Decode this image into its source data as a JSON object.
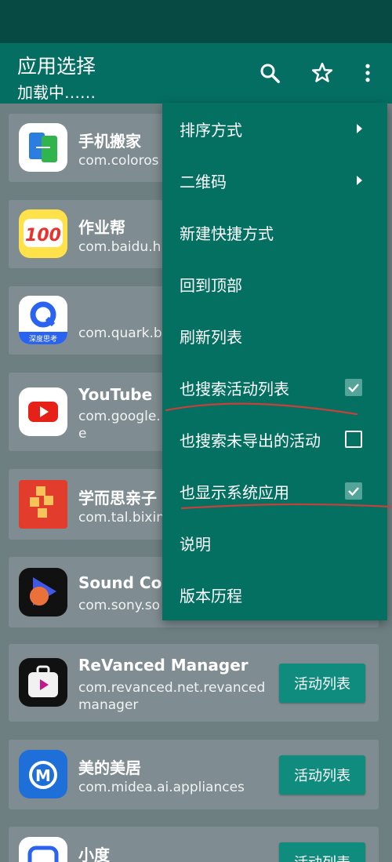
{
  "appbar": {
    "title": "应用选择",
    "subtitle": "加载中……"
  },
  "apps": [
    {
      "name": "手机搬家",
      "package": "com.coloros"
    },
    {
      "name": "作业帮",
      "package": "com.baidu.h"
    },
    {
      "name": "",
      "package": "com.quark.b",
      "icon_text": "深度思考"
    },
    {
      "name": "YouTube",
      "package": "com.google.\ne"
    },
    {
      "name": "学而思亲子",
      "package": "com.tal.bixin"
    },
    {
      "name": "Sound Con",
      "package": "com.sony.so"
    },
    {
      "name": "ReVanced Manager",
      "package": "com.revanced.net.revanced\nmanager",
      "button": "活动列表"
    },
    {
      "name": "美的美居",
      "package": "com.midea.ai.appliances",
      "button": "活动列表"
    },
    {
      "name": "小度",
      "package": "",
      "button": "活动列表"
    }
  ],
  "menu": {
    "items": [
      {
        "label": "排序方式",
        "type": "submenu"
      },
      {
        "label": "二维码",
        "type": "submenu"
      },
      {
        "label": "新建快捷方式",
        "type": "action"
      },
      {
        "label": "回到顶部",
        "type": "action"
      },
      {
        "label": "刷新列表",
        "type": "action"
      },
      {
        "label": "也搜索活动列表",
        "type": "checkbox",
        "checked": true
      },
      {
        "label": "也搜索未导出的活动",
        "type": "checkbox",
        "checked": false
      },
      {
        "label": "也显示系统应用",
        "type": "checkbox",
        "checked": true
      },
      {
        "label": "说明",
        "type": "action"
      },
      {
        "label": "版本历程",
        "type": "action"
      }
    ]
  },
  "icons": {
    "search": "search-icon",
    "favorite": "star-outline-icon",
    "overflow": "more-vert-icon"
  },
  "colors": {
    "appbar": "#056e63",
    "statusbar": "#074a44",
    "menu": "#047062",
    "button": "#0f8c7d",
    "annotation": "#c8403a"
  }
}
